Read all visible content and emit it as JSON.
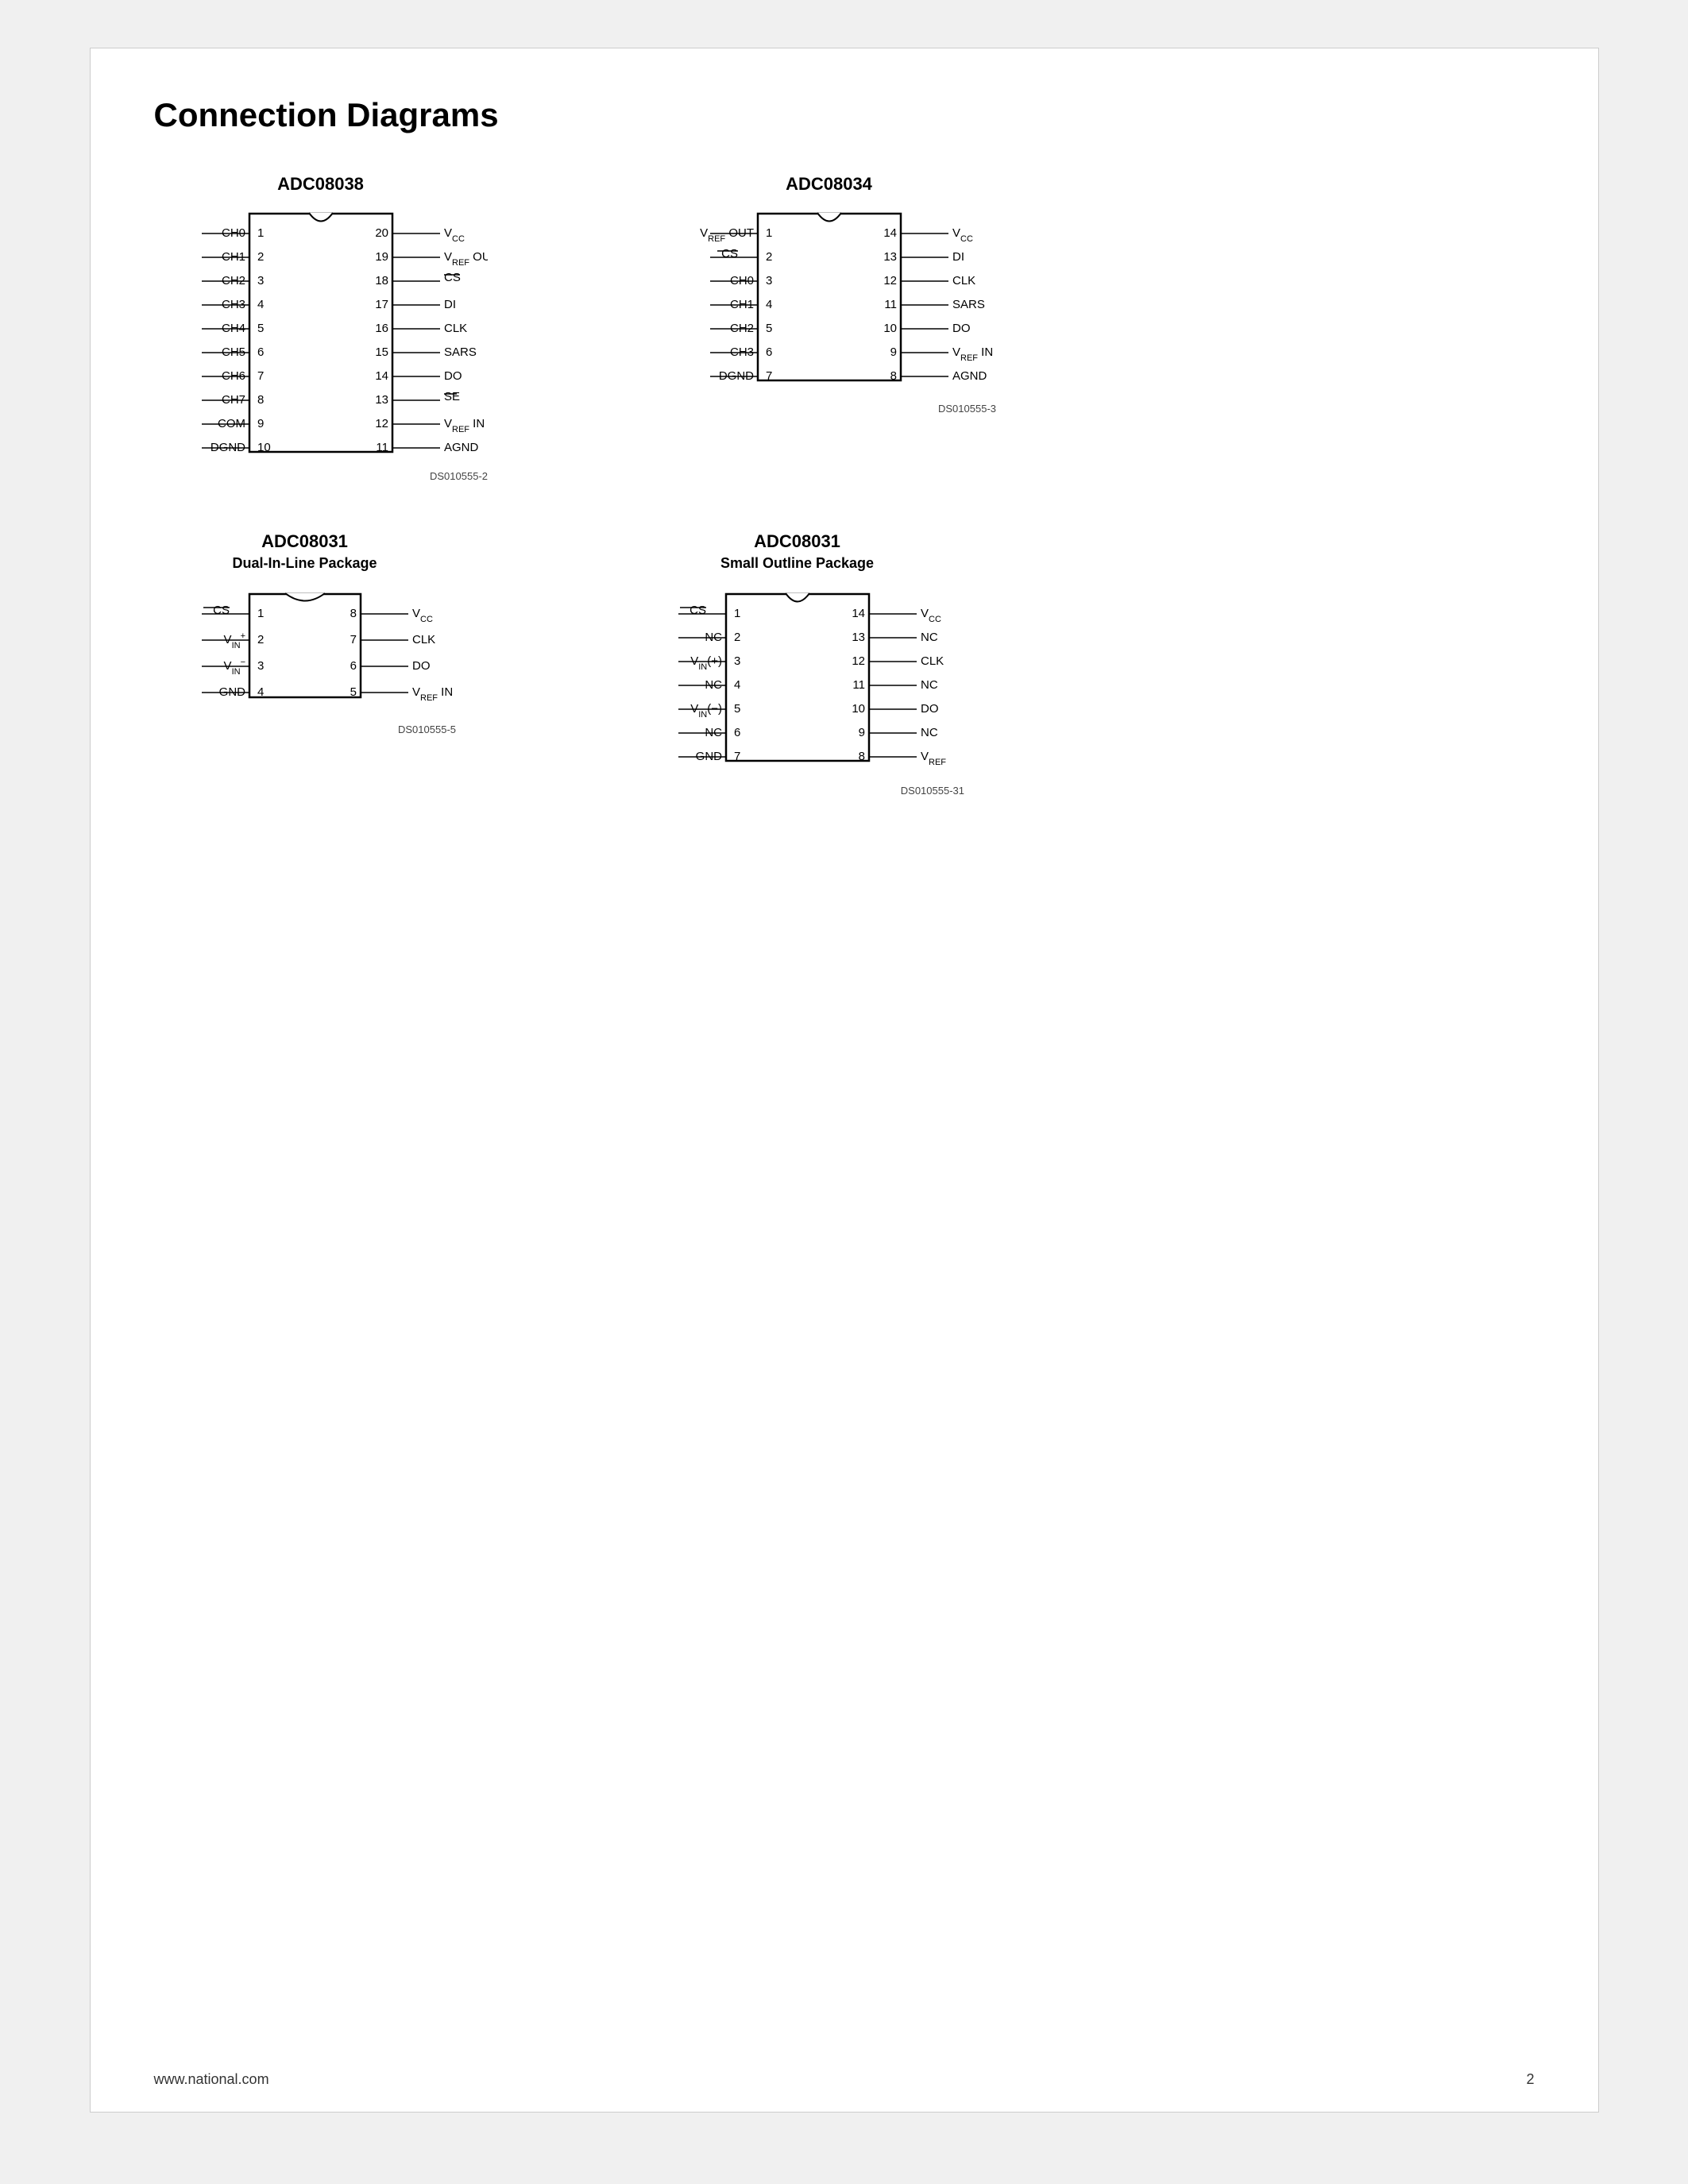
{
  "page": {
    "title": "Connection Diagrams",
    "footer_url": "www.national.com",
    "footer_page": "2"
  },
  "diagrams": {
    "adc08038": {
      "title": "ADC08038",
      "subtitle": "",
      "ds_label": "DS010555-2",
      "left_pins": [
        {
          "num": "1",
          "label": "CH0"
        },
        {
          "num": "2",
          "label": "CH1"
        },
        {
          "num": "3",
          "label": "CH2"
        },
        {
          "num": "4",
          "label": "CH3"
        },
        {
          "num": "5",
          "label": "CH4"
        },
        {
          "num": "6",
          "label": "CH5"
        },
        {
          "num": "7",
          "label": "CH6"
        },
        {
          "num": "8",
          "label": "CH7"
        },
        {
          "num": "9",
          "label": "COM"
        },
        {
          "num": "10",
          "label": "DGND"
        }
      ],
      "right_pins": [
        {
          "num": "20",
          "label": "V CC"
        },
        {
          "num": "19",
          "label": "V REF OUT"
        },
        {
          "num": "18",
          "label": "͜CS"
        },
        {
          "num": "17",
          "label": "DI"
        },
        {
          "num": "16",
          "label": "CLK"
        },
        {
          "num": "15",
          "label": "SARS"
        },
        {
          "num": "14",
          "label": "DO"
        },
        {
          "num": "13",
          "label": "͜SE"
        },
        {
          "num": "12",
          "label": "V REF IN"
        },
        {
          "num": "11",
          "label": "AGND"
        }
      ]
    },
    "adc08034": {
      "title": "ADC08034",
      "subtitle": "",
      "ds_label": "DS010555-3",
      "left_pins": [
        {
          "num": "1",
          "label": "V REF OUT"
        },
        {
          "num": "2",
          "label": "͜CS"
        },
        {
          "num": "3",
          "label": "CH0"
        },
        {
          "num": "4",
          "label": "CH1"
        },
        {
          "num": "5",
          "label": "CH2"
        },
        {
          "num": "6",
          "label": "CH3"
        },
        {
          "num": "7",
          "label": "DGND"
        }
      ],
      "right_pins": [
        {
          "num": "14",
          "label": "V CC"
        },
        {
          "num": "13",
          "label": "DI"
        },
        {
          "num": "12",
          "label": "CLK"
        },
        {
          "num": "11",
          "label": "SARS"
        },
        {
          "num": "10",
          "label": "DO"
        },
        {
          "num": "9",
          "label": "V REF IN"
        },
        {
          "num": "8",
          "label": "AGND"
        }
      ]
    },
    "adc08031_dil": {
      "title": "ADC08031",
      "subtitle": "Dual-In-Line Package",
      "ds_label": "DS010555-5",
      "left_pins": [
        {
          "num": "1",
          "label": "͜CS"
        },
        {
          "num": "2",
          "label": "V IN⁺"
        },
        {
          "num": "3",
          "label": "V IN⁻"
        },
        {
          "num": "4",
          "label": "GND"
        }
      ],
      "right_pins": [
        {
          "num": "8",
          "label": "V CC"
        },
        {
          "num": "7",
          "label": "CLK"
        },
        {
          "num": "6",
          "label": "DO"
        },
        {
          "num": "5",
          "label": "V REF IN"
        }
      ]
    },
    "adc08031_so": {
      "title": "ADC08031",
      "subtitle": "Small Outline Package",
      "ds_label": "DS010555-31",
      "left_pins": [
        {
          "num": "1",
          "label": "͜CS"
        },
        {
          "num": "2",
          "label": "NC"
        },
        {
          "num": "3",
          "label": "V IN (+)"
        },
        {
          "num": "4",
          "label": "NC"
        },
        {
          "num": "5",
          "label": "V IN (−)"
        },
        {
          "num": "6",
          "label": "NC"
        },
        {
          "num": "7",
          "label": "GND"
        }
      ],
      "right_pins": [
        {
          "num": "14",
          "label": "V CC"
        },
        {
          "num": "13",
          "label": "NC"
        },
        {
          "num": "12",
          "label": "CLK"
        },
        {
          "num": "11",
          "label": "NC"
        },
        {
          "num": "10",
          "label": "DO"
        },
        {
          "num": "9",
          "label": "NC"
        },
        {
          "num": "8",
          "label": "V REF"
        }
      ]
    }
  }
}
